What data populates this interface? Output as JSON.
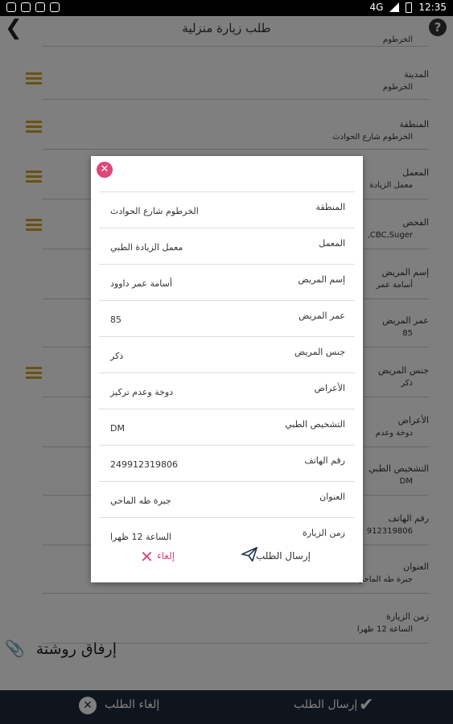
{
  "status_bar": {
    "time": "12:35",
    "network": "4G"
  },
  "header": {
    "title": "طلب زيارة منزلية"
  },
  "form": [
    {
      "label": "",
      "value": "الخرطوم"
    },
    {
      "label": "المدينة",
      "value": "الخرطوم"
    },
    {
      "label": "المنطقة",
      "value": "الخرطوم شارع الحوادث"
    },
    {
      "label": "المعمل",
      "value": "معمل الزيادة"
    },
    {
      "label": "الفحص",
      "value": "CBC,Suger,"
    },
    {
      "label": "إسم المريض",
      "value": "أسامة عمر"
    },
    {
      "label": "عمر المريض",
      "value": "85"
    },
    {
      "label": "جنس المريض",
      "value": "ذكر"
    },
    {
      "label": "الأعراض",
      "value": "دوخة وعدم"
    },
    {
      "label": "التشخيص الطبي",
      "value": "DM"
    },
    {
      "label": "رقم الهاتف",
      "value": "912319806"
    },
    {
      "label": "العنوان",
      "value": "جبرة طه الماحي"
    },
    {
      "label": "زمن الزيارة",
      "value": "الساعة 12 ظهرا"
    }
  ],
  "attach_label": "إرفاق روشتة",
  "bottom_bar": {
    "send_label": "إرسال الطلب",
    "cancel_label": "إلغاء الطلب"
  },
  "dialog": {
    "rows": [
      {
        "label": "المنطقة",
        "value": "الخرطوم شارع الحوادث"
      },
      {
        "label": "المعمل",
        "value": "معمل الزيادة الطبي"
      },
      {
        "label": "إسم المريض",
        "value": "أسامة عمر داوود"
      },
      {
        "label": "عمر المريض",
        "value": "85"
      },
      {
        "label": "جنس المريض",
        "value": "ذكر"
      },
      {
        "label": "الأعراض",
        "value": "دوخة وعدم تركيز"
      },
      {
        "label": "التشخيص الطبي",
        "value": "DM"
      },
      {
        "label": "رقم الهاتف",
        "value": "249912319806"
      },
      {
        "label": "العنوان",
        "value": "جبرة طه الماحي"
      },
      {
        "label": "زمن الزيارة",
        "value": "الساعة 12 ظهرا"
      }
    ],
    "send_label": "إرسال الطلب",
    "cancel_label": "إلغاء"
  },
  "colors": {
    "accent": "#d5a21f",
    "bottom_bar": "#1f2a3a",
    "close": "#e0457b"
  },
  "icons": [
    "back-icon",
    "help-icon",
    "menu-icon",
    "paperclip-icon",
    "checkmark-icon",
    "close-circle-icon",
    "send-icon",
    "x-icon"
  ]
}
